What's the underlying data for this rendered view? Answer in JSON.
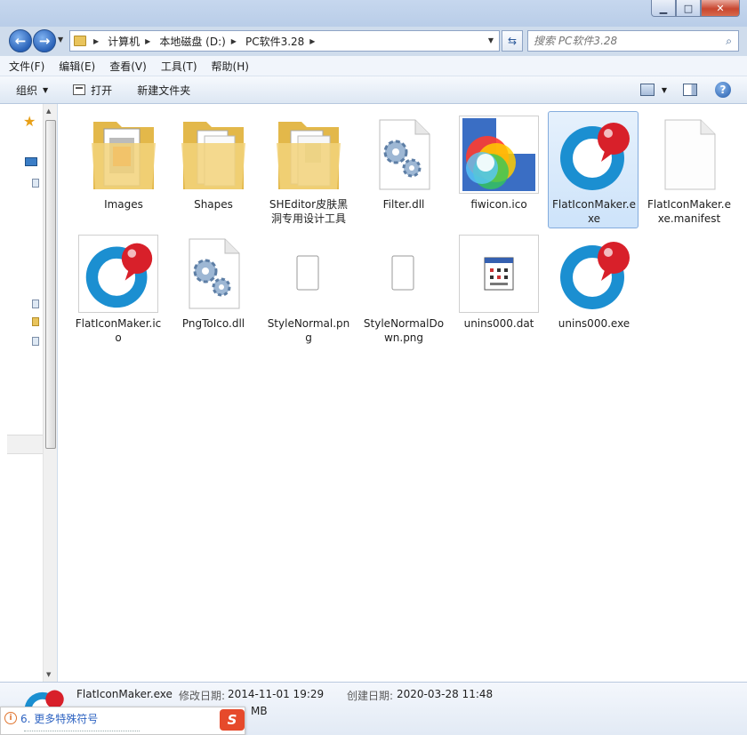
{
  "window": {
    "min_label": "▁",
    "max_label": "□",
    "close_label": "✕"
  },
  "address": {
    "crumbs": [
      "计算机",
      "本地磁盘 (D:)",
      "PC软件3.28"
    ],
    "search_placeholder": "搜索 PC软件3.28"
  },
  "menu": [
    "文件(F)",
    "编辑(E)",
    "查看(V)",
    "工具(T)",
    "帮助(H)"
  ],
  "toolbar": {
    "organize": "组织",
    "open": "打开",
    "new_folder": "新建文件夹"
  },
  "files": [
    {
      "name": "Images",
      "type": "folder-images"
    },
    {
      "name": "Shapes",
      "type": "folder-docs"
    },
    {
      "name": "SHEditor皮肤黑洞专用设计工具",
      "type": "folder-docs"
    },
    {
      "name": "Filter.dll",
      "type": "dll"
    },
    {
      "name": "fiwicon.ico",
      "type": "ico-rainbow"
    },
    {
      "name": "FlatIconMaker.exe",
      "type": "app",
      "selected": true
    },
    {
      "name": "FlatIconMaker.exe.manifest",
      "type": "blank"
    },
    {
      "name": "FlatIconMaker.ico",
      "type": "app-framed"
    },
    {
      "name": "PngToIco.dll",
      "type": "dll"
    },
    {
      "name": "StyleNormal.png",
      "type": "small-page"
    },
    {
      "name": "StyleNormalDown.png",
      "type": "small-page"
    },
    {
      "name": "unins000.dat",
      "type": "dat-framed"
    },
    {
      "name": "unins000.exe",
      "type": "app"
    }
  ],
  "details": {
    "name": "FlatIconMaker.exe",
    "modified_label": "修改日期:",
    "modified": "2014-11-01 19:29",
    "created_label": "创建日期:",
    "created": "2020-03-28 11:48",
    "size_fragment": "MB"
  },
  "ime": {
    "info": "i",
    "text": "6. 更多特殊符号",
    "logo": "S"
  },
  "colors": {
    "app_blue": "#1b8fd1",
    "app_red": "#d8202a",
    "folder": "#f0cd6a",
    "selection": "#cde3fa"
  }
}
